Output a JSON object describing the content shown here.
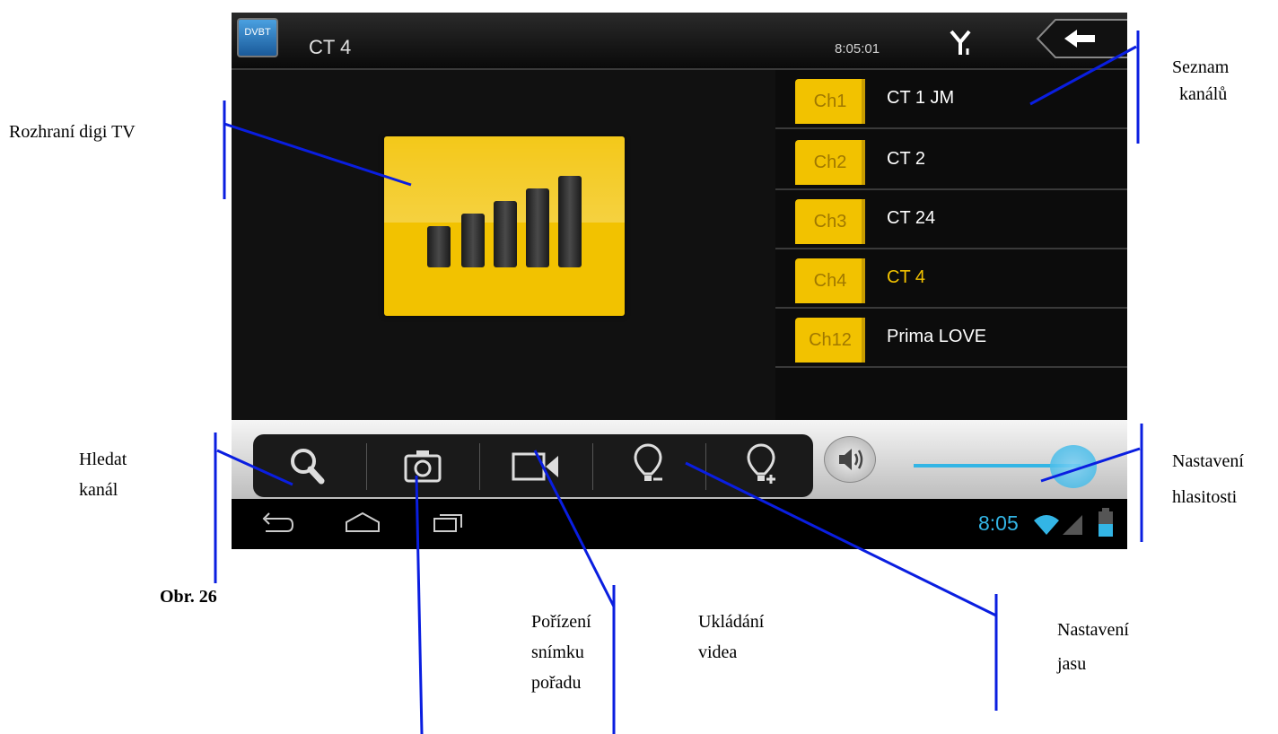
{
  "header": {
    "app_icon_label": "DVBT",
    "channel": "CT 4",
    "time": "8:05:01"
  },
  "channels": [
    {
      "badge": "Ch1",
      "name": "CT 1 JM",
      "active": false
    },
    {
      "badge": "Ch2",
      "name": "CT 2",
      "active": false
    },
    {
      "badge": "Ch3",
      "name": "CT 24",
      "active": false
    },
    {
      "badge": "Ch4",
      "name": "CT 4",
      "active": true
    },
    {
      "badge": "Ch12",
      "name": "Prima LOVE",
      "active": false
    }
  ],
  "controls": {
    "volume_level": 0.95
  },
  "statusbar": {
    "time": "8:05"
  },
  "annotations": {
    "seznam_l1": "Seznam",
    "seznam_l2": "kanálů",
    "rozhrani": "Rozhraní digi TV",
    "hledat_l1": "Hledat",
    "hledat_l2": "kanál",
    "obr": "Obr. 26",
    "snimek_l1": "Pořízení",
    "snimek_l2": "snímku",
    "snimek_l3": "pořadu",
    "video_l1": "Ukládání",
    "video_l2": "videa",
    "jas_l1": "Nastavení",
    "jas_l2": "jasu",
    "hlas_l1": "Nastavení",
    "hlas_l2": "hlasitosti"
  },
  "colors": {
    "accent_yellow": "#f2c200",
    "android_blue": "#33b5e5",
    "annotation_blue": "#0a1ee0"
  },
  "icons": [
    "dvbt-app-icon",
    "antenna-icon",
    "back-arrow-icon",
    "signal-bars-icon",
    "search-icon",
    "camera-icon",
    "video-camera-icon",
    "brightness-down-icon",
    "brightness-up-icon",
    "volume-icon",
    "nav-back-icon",
    "nav-home-icon",
    "nav-recents-icon",
    "wifi-icon",
    "cell-signal-icon",
    "battery-icon"
  ]
}
